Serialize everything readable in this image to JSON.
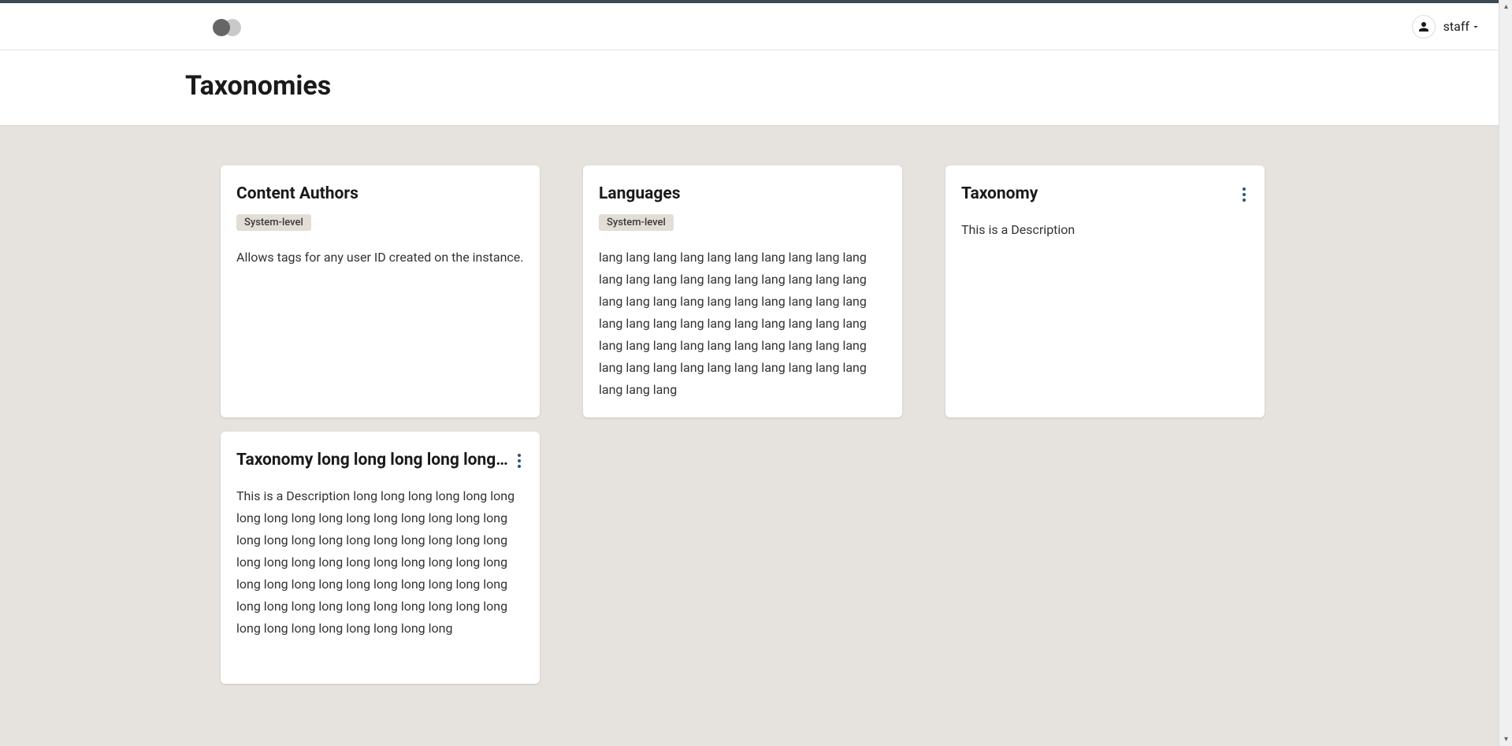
{
  "header": {
    "user_name": "staff"
  },
  "page": {
    "title": "Taxonomies"
  },
  "cards": [
    {
      "title": "Content Authors",
      "badge": "System-level",
      "description": "Allows tags for any user ID created on the instance.",
      "has_menu": false
    },
    {
      "title": "Languages",
      "badge": "System-level",
      "description": "lang lang lang lang lang lang lang lang lang lang lang lang lang lang lang lang lang lang lang lang lang lang lang lang lang lang lang lang lang lang lang lang lang lang lang lang lang lang lang lang lang lang lang lang lang lang lang lang lang lang lang lang lang lang lang lang lang lang lang lang lang lang lang",
      "has_menu": false
    },
    {
      "title": "Taxonomy",
      "badge": null,
      "description": "This is a Description",
      "has_menu": true
    },
    {
      "title": "Taxonomy long long long long long long long long",
      "badge": null,
      "description": "This is a Description long long long long long long long long long long long long long long long long long long long long long long long long long long long long long long long long long long long long long long long long long long long long long long long long long long long long long long long long long long long long long long long long",
      "has_menu": true
    }
  ]
}
